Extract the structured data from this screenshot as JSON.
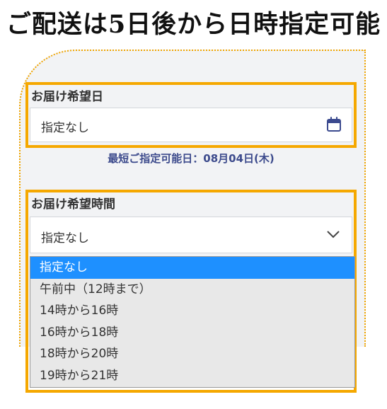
{
  "headline": "ご配送は5日後から日時指定可能",
  "delivery_date": {
    "label": "お届け希望日",
    "value": "指定なし",
    "icon": "calendar-icon",
    "note": "最短ご指定可能日：08月04日(木)"
  },
  "delivery_time": {
    "label": "お届け希望時間",
    "value": "指定なし",
    "icon": "chevron-down-icon",
    "options": [
      {
        "label": "指定なし",
        "selected": true
      },
      {
        "label": "午前中（12時まで）",
        "selected": false
      },
      {
        "label": "14時から16時",
        "selected": false
      },
      {
        "label": "16時から18時",
        "selected": false
      },
      {
        "label": "18時から20時",
        "selected": false
      },
      {
        "label": "19時から21時",
        "selected": false
      }
    ]
  },
  "colors": {
    "highlight_border": "#f5a800",
    "selected_option": "#1e90ff",
    "note_text": "#3c4a8c",
    "calendar_icon": "#3b4a8f"
  }
}
